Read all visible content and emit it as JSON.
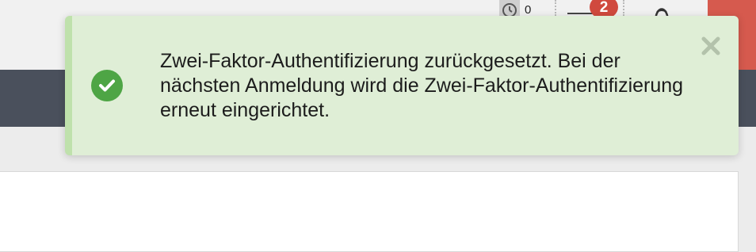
{
  "header": {
    "timer": {
      "icon": "stopwatch-icon",
      "count": "0"
    },
    "messages": {
      "icon": "messages-icon",
      "badge_count": "2"
    },
    "user": {
      "icon": "user-avatar-icon"
    },
    "logout": {
      "icon": "logout-icon"
    }
  },
  "toast": {
    "type": "success",
    "icon": "check-circle-icon",
    "message": "Zwei-Faktor-Authentifizierung zurückgesetzt. Bei der nächsten Anmeldung wird die Zwei-Faktor-Authentifizierung erneut eingerichtet.",
    "close_icon": "close-icon"
  },
  "colors": {
    "toast_background": "#dfeed6",
    "toast_accent": "#bfe1ac",
    "success_icon": "#4ea545",
    "badge": "#d0493e",
    "navbar": "#4a505c",
    "logout": "#d65a4e"
  }
}
